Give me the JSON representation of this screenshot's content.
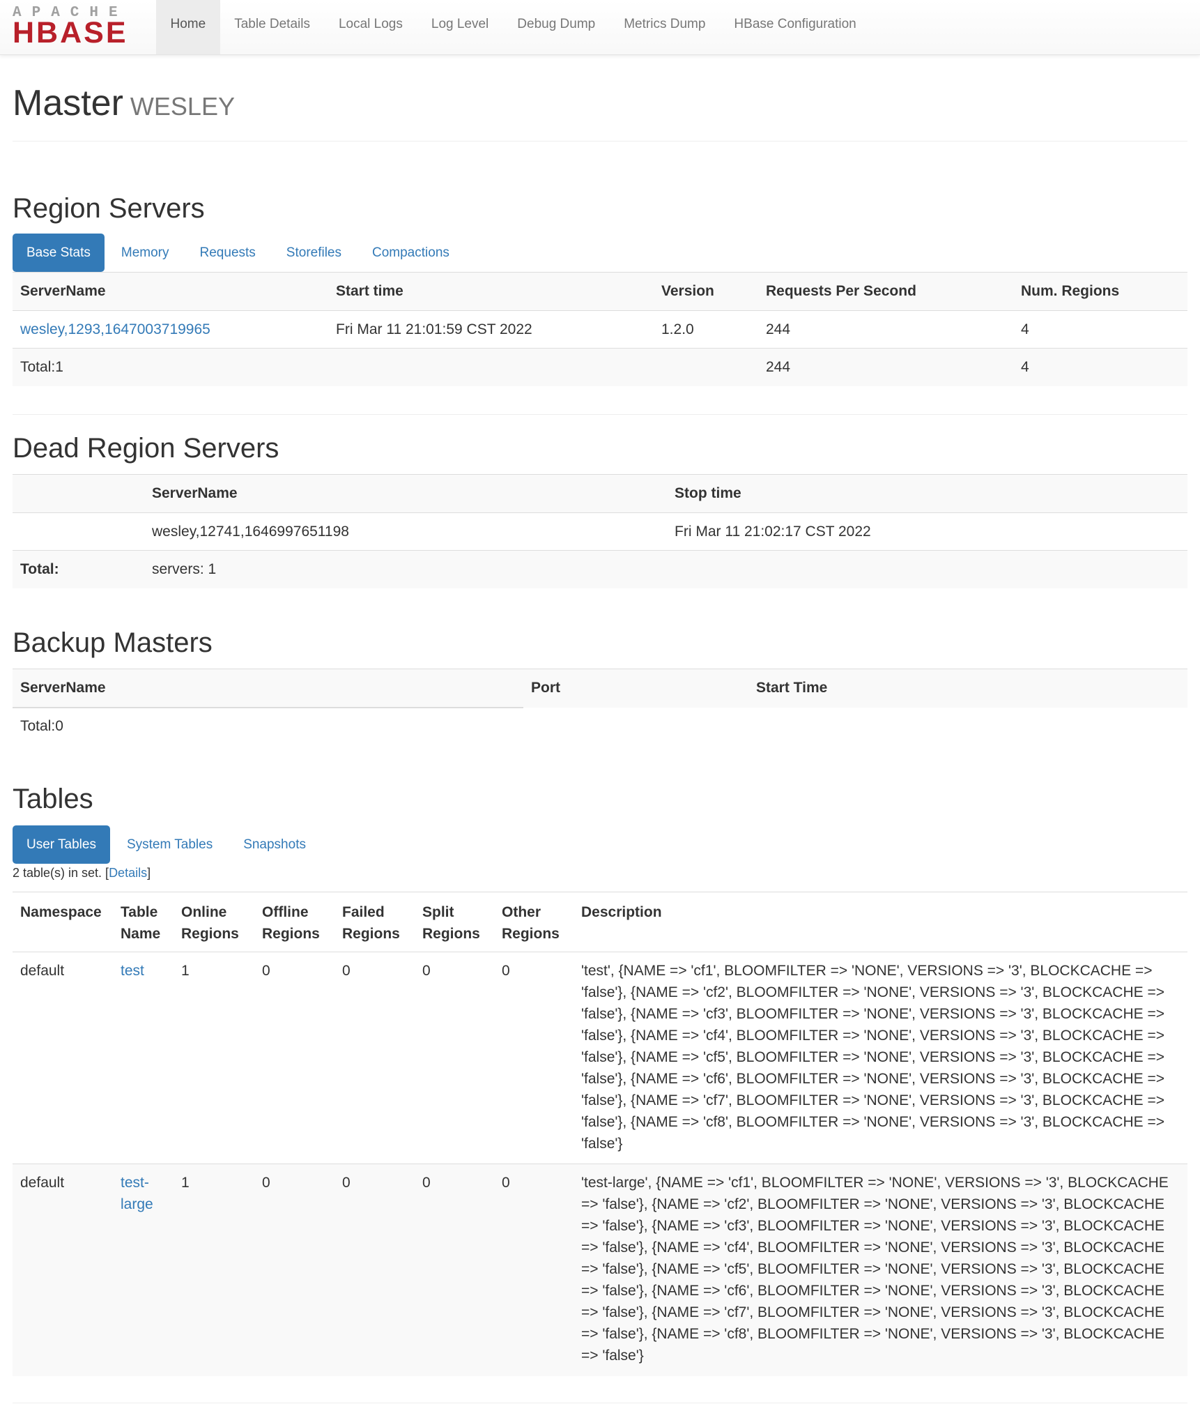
{
  "logo": {
    "top": "APACHE",
    "bottom": "HBASE"
  },
  "nav": [
    "Home",
    "Table Details",
    "Local Logs",
    "Log Level",
    "Debug Dump",
    "Metrics Dump",
    "HBase Configuration"
  ],
  "header": {
    "title": "Master",
    "host": "WESLEY"
  },
  "region_servers": {
    "heading": "Region Servers",
    "tabs": [
      "Base Stats",
      "Memory",
      "Requests",
      "Storefiles",
      "Compactions"
    ],
    "columns": [
      "ServerName",
      "Start time",
      "Version",
      "Requests Per Second",
      "Num. Regions"
    ],
    "rows": [
      {
        "server": "wesley,1293,1647003719965",
        "start": "Fri Mar 11 21:01:59 CST 2022",
        "version": "1.2.0",
        "rps": "244",
        "regions": "4"
      }
    ],
    "total": {
      "label": "Total:1",
      "rps": "244",
      "regions": "4"
    }
  },
  "dead_region_servers": {
    "heading": "Dead Region Servers",
    "columns": [
      "ServerName",
      "Stop time"
    ],
    "rows": [
      {
        "server": "wesley,12741,1646997651198",
        "stop": "Fri Mar 11 21:02:17 CST 2022"
      }
    ],
    "total": {
      "label": "Total:",
      "value": "servers: 1"
    }
  },
  "backup_masters": {
    "heading": "Backup Masters",
    "columns": [
      "ServerName",
      "Port",
      "Start Time"
    ],
    "total": "Total:0"
  },
  "tables": {
    "heading": "Tables",
    "tabs": [
      "User Tables",
      "System Tables",
      "Snapshots"
    ],
    "set_info": {
      "prefix": "2 table(s) in set. [",
      "link": "Details",
      "suffix": "]"
    },
    "columns": {
      "namespace": "Namespace",
      "table_a": "Table",
      "table_b": "Name",
      "online_a": "Online",
      "online_b": "Regions",
      "offline_a": "Offline",
      "offline_b": "Regions",
      "failed_a": "Failed",
      "failed_b": "Regions",
      "split_a": "Split",
      "split_b": "Regions",
      "other_a": "Other",
      "other_b": "Regions",
      "description": "Description"
    },
    "rows": [
      {
        "namespace": "default",
        "name": "test",
        "online": "1",
        "offline": "0",
        "failed": "0",
        "split": "0",
        "other": "0",
        "description": "'test', {NAME => 'cf1', BLOOMFILTER => 'NONE', VERSIONS => '3', BLOCKCACHE => 'false'}, {NAME => 'cf2', BLOOMFILTER => 'NONE', VERSIONS => '3', BLOCKCACHE => 'false'}, {NAME => 'cf3', BLOOMFILTER => 'NONE', VERSIONS => '3', BLOCKCACHE => 'false'}, {NAME => 'cf4', BLOOMFILTER => 'NONE', VERSIONS => '3', BLOCKCACHE => 'false'}, {NAME => 'cf5', BLOOMFILTER => 'NONE', VERSIONS => '3', BLOCKCACHE => 'false'}, {NAME => 'cf6', BLOOMFILTER => 'NONE', VERSIONS => '3', BLOCKCACHE => 'false'}, {NAME => 'cf7', BLOOMFILTER => 'NONE', VERSIONS => '3', BLOCKCACHE => 'false'}, {NAME => 'cf8', BLOOMFILTER => 'NONE', VERSIONS => '3', BLOCKCACHE => 'false'}"
      },
      {
        "namespace": "default",
        "name": "test-large",
        "online": "1",
        "offline": "0",
        "failed": "0",
        "split": "0",
        "other": "0",
        "description": "'test-large', {NAME => 'cf1', BLOOMFILTER => 'NONE', VERSIONS => '3', BLOCKCACHE => 'false'}, {NAME => 'cf2', BLOOMFILTER => 'NONE', VERSIONS => '3', BLOCKCACHE => 'false'}, {NAME => 'cf3', BLOOMFILTER => 'NONE', VERSIONS => '3', BLOCKCACHE => 'false'}, {NAME => 'cf4', BLOOMFILTER => 'NONE', VERSIONS => '3', BLOCKCACHE => 'false'}, {NAME => 'cf5', BLOOMFILTER => 'NONE', VERSIONS => '3', BLOCKCACHE => 'false'}, {NAME => 'cf6', BLOOMFILTER => 'NONE', VERSIONS => '3', BLOCKCACHE => 'false'}, {NAME => 'cf7', BLOOMFILTER => 'NONE', VERSIONS => '3', BLOCKCACHE => 'false'}, {NAME => 'cf8', BLOOMFILTER => 'NONE', VERSIONS => '3', BLOCKCACHE => 'false'}"
      }
    ]
  },
  "colors": {
    "link": "#337ab7",
    "active_pill": "#337ab7",
    "brand": "#b8202a",
    "stripe": "#f9f9f9"
  }
}
